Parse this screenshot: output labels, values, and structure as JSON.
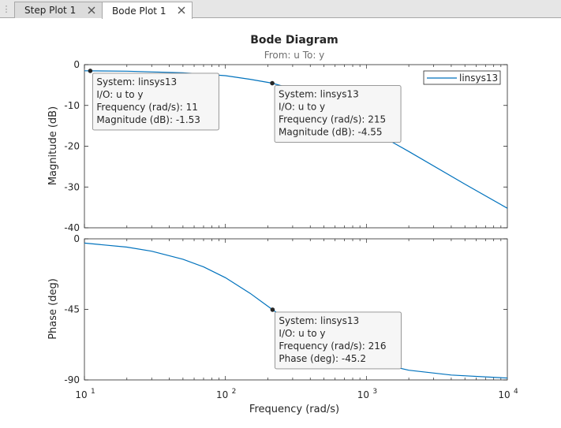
{
  "tabs": [
    {
      "label": "Step Plot 1",
      "active": false
    },
    {
      "label": "Bode Plot 1",
      "active": true
    }
  ],
  "plot": {
    "title": "Bode Diagram",
    "subtitle": "From: u  To: y",
    "xlabel": "Frequency  (rad/s)",
    "line_color": "#0072bd"
  },
  "chart_data": [
    {
      "type": "line",
      "panel": "magnitude",
      "ylabel": "Magnitude (dB)",
      "xscale": "log",
      "xlim": [
        10,
        10000
      ],
      "ylim": [
        -40,
        0
      ],
      "yticks": [
        "0",
        "-10",
        "-20",
        "-30",
        "-40"
      ],
      "grid": false,
      "legend": {
        "entries": [
          "linsys13"
        ],
        "placement": "top-right"
      },
      "series": [
        {
          "name": "linsys13",
          "x": [
            10,
            11,
            20,
            50,
            100,
            150,
            215,
            300,
            500,
            700,
            1000,
            2000,
            5000,
            10000
          ],
          "y": [
            -1.5,
            -1.53,
            -1.6,
            -2.0,
            -2.7,
            -3.6,
            -4.55,
            -6.0,
            -9.5,
            -12.3,
            -15.4,
            -21.3,
            -29.3,
            -35.2
          ]
        }
      ],
      "datatips": [
        {
          "x": 11,
          "y": -1.53,
          "lines": [
            "System: linsys13",
            "I/O: u to y",
            "Frequency (rad/s): 11",
            "Magnitude (dB): -1.53"
          ]
        },
        {
          "x": 215,
          "y": -4.55,
          "lines": [
            "System: linsys13",
            "I/O: u to y",
            "Frequency (rad/s): 215",
            "Magnitude (dB): -4.55"
          ]
        }
      ]
    },
    {
      "type": "line",
      "panel": "phase",
      "ylabel": "Phase (deg)",
      "xscale": "log",
      "xlim": [
        10,
        10000
      ],
      "ylim": [
        -90,
        0
      ],
      "yticks": [
        "0",
        "-45",
        "-90"
      ],
      "xticks": [
        {
          "base": "10",
          "exp": "1"
        },
        {
          "base": "10",
          "exp": "2"
        },
        {
          "base": "10",
          "exp": "3"
        },
        {
          "base": "10",
          "exp": "4"
        }
      ],
      "grid": false,
      "series": [
        {
          "name": "linsys13",
          "x": [
            10,
            20,
            30,
            50,
            70,
            100,
            150,
            216,
            300,
            500,
            700,
            1000,
            2000,
            4000,
            10000
          ],
          "y": [
            -2.7,
            -5.3,
            -7.9,
            -13.0,
            -17.9,
            -24.8,
            -34.8,
            -45.2,
            -54.2,
            -66.6,
            -72.1,
            -77.6,
            -83.8,
            -86.9,
            -88.8
          ]
        }
      ],
      "datatips": [
        {
          "x": 216,
          "y": -45.2,
          "lines": [
            "System: linsys13",
            "I/O: u to y",
            "Frequency (rad/s): 216",
            "Phase (deg): -45.2"
          ]
        }
      ]
    }
  ]
}
